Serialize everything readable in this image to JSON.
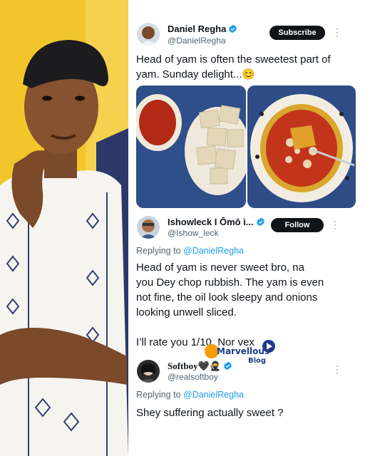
{
  "main_tweet": {
    "author_name": "Daniel Regha",
    "author_handle": "@DanielRegha",
    "subscribe_label": "Subscribe",
    "text": "Head of yam is often the sweetest part of yam. Sunday delight...😊"
  },
  "reply_1": {
    "author_name": "Ishowleck I Ōmō ì...",
    "author_handle": "@Ishow_leck",
    "follow_label": "Follow",
    "replying_to_prefix": "Replying to ",
    "replying_to_mention": "@DanielRegha",
    "text_lines": [
      "Head of yam is never sweet bro, na",
      "you Dey chop rubbish. The yam is even",
      "not fine, the oil look sleepy and onions",
      "looking unwell sliced.",
      "",
      "I’ll rate you 1/10. Nor vex"
    ]
  },
  "reply_2": {
    "author_name": "Softboy🖤🥷",
    "author_handle": "@realsoftboy",
    "replying_to_prefix": "Replying to ",
    "replying_to_mention": "@DanielRegha",
    "text": "Shey suffering actually sweet ?"
  },
  "watermark": {
    "line1": "Marvellous",
    "line2": "Blog"
  },
  "colors": {
    "verified": "#1d9bf0",
    "mention": "#1d9bf0",
    "button_bg": "#0f1419",
    "watermark_orange": "#f59e0b",
    "watermark_blue": "#1e3a8a"
  },
  "icons": [
    "verified-badge-icon",
    "more-options-icon",
    "play-icon"
  ]
}
